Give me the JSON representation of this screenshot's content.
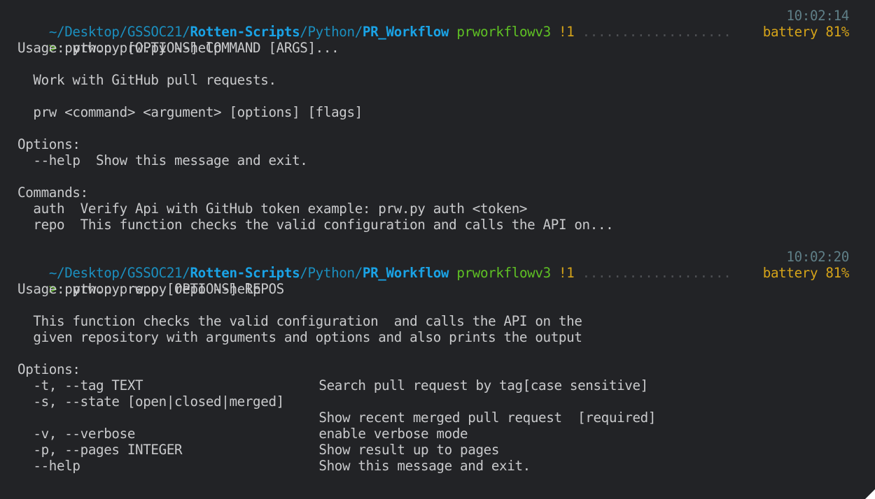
{
  "sessions": [
    {
      "prompt": {
        "path_segments": [
          {
            "text": "~/Desktop/GSSOC21/",
            "style": "dim"
          },
          {
            "text": "Rotten-Scripts",
            "style": "bold"
          },
          {
            "text": "/Python/",
            "style": "dim"
          },
          {
            "text": "PR_Workflow",
            "style": "bold"
          }
        ],
        "branch": "prworkflowv3",
        "git_status": "!1",
        "dots": "...................",
        "time": "10:02:14",
        "battery": "battery 81%",
        "prompt_char": ">",
        "command": "python prw.py --help"
      },
      "output": {
        "usage": "Usage: prw.py [OPTIONS] COMMAND [ARGS]...",
        "description": "  Work with GitHub pull requests.",
        "syntax": "  prw <command> <argument> [options] [flags]",
        "options_header": "Options:",
        "options": [
          {
            "flag": "--help",
            "desc": "Show this message and exit."
          }
        ],
        "commands_header": "Commands:",
        "commands": [
          {
            "name": "auth",
            "desc": "Verify Api with GitHub token example: prw.py auth <token>"
          },
          {
            "name": "repo",
            "desc": "This function checks the valid configuration and calls the API on..."
          }
        ]
      }
    },
    {
      "prompt": {
        "path_segments": [
          {
            "text": "~/Desktop/GSSOC21/",
            "style": "dim"
          },
          {
            "text": "Rotten-Scripts",
            "style": "bold"
          },
          {
            "text": "/Python/",
            "style": "dim"
          },
          {
            "text": "PR_Workflow",
            "style": "bold"
          }
        ],
        "branch": "prworkflowv3",
        "git_status": "!1",
        "dots": "...................",
        "time": "10:02:20",
        "battery": "battery 81%",
        "prompt_char": ">",
        "command": "python prw.py repo --help"
      },
      "output": {
        "usage": "Usage: prw.py repo [OPTIONS] REPOS",
        "description_lines": [
          "  This function checks the valid configuration  and calls the API on the",
          "  given repository with arguments and options and also prints the output"
        ],
        "options_header": "Options:",
        "options": [
          {
            "flag": "-t, --tag TEXT",
            "desc": "Search pull request by tag[case sensitive]"
          },
          {
            "flag": "-s, --state [open|closed|merged]",
            "desc": ""
          },
          {
            "flag": "",
            "desc": "Show recent merged pull request  [required]"
          },
          {
            "flag": "-v, --verbose",
            "desc": "enable verbose mode"
          },
          {
            "flag": "-p, --pages INTEGER",
            "desc": "Show result up to pages"
          },
          {
            "flag": "--help",
            "desc": "Show this message and exit."
          }
        ]
      }
    }
  ]
}
